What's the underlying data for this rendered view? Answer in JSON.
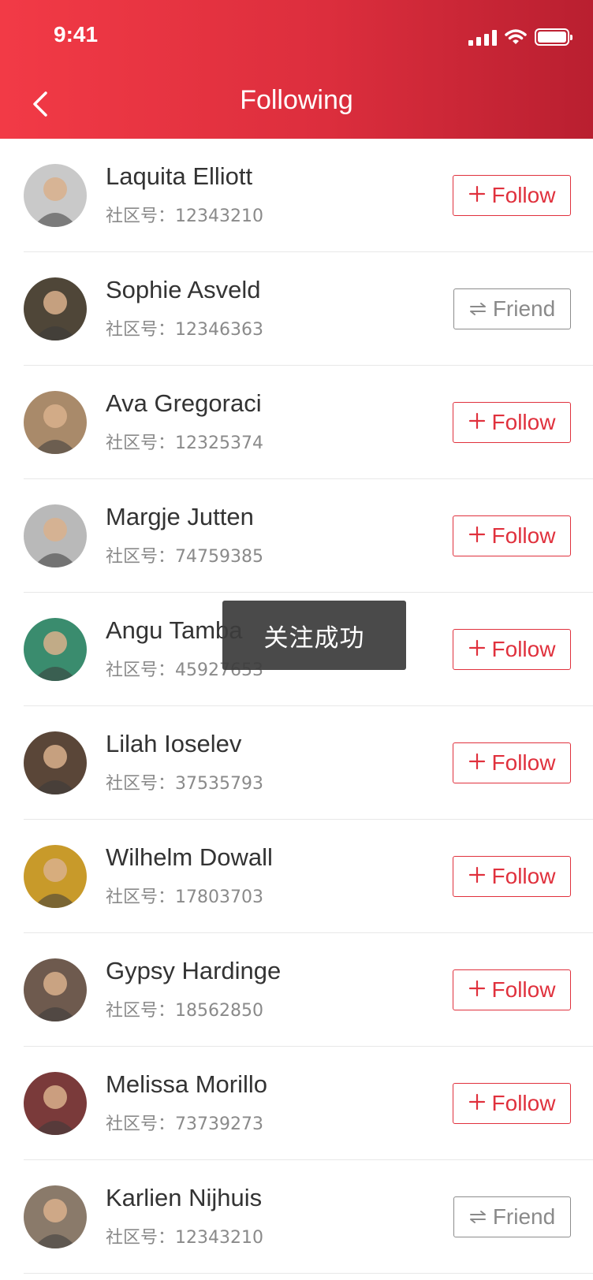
{
  "status_bar": {
    "time": "9:41"
  },
  "header": {
    "title": "Following"
  },
  "toast": {
    "text": "关注成功"
  },
  "buttons": {
    "follow_label": "Follow",
    "friend_label": "Friend",
    "follow_icon": "plus-icon",
    "friend_icon": "swap-arrows-icon"
  },
  "colors": {
    "header_start": "#f23a46",
    "header_end": "#b91f30",
    "accent": "#e0313d"
  },
  "users": [
    {
      "name": "Laquita Elliott",
      "cid": "社区号：12343210",
      "status": "Follow",
      "avatar_color": "#c9c9c9"
    },
    {
      "name": "Sophie Asveld",
      "cid": "社区号：12346363",
      "status": "Friend",
      "avatar_color": "#4f4638"
    },
    {
      "name": "Ava Gregoraci",
      "cid": "社区号：12325374",
      "status": "Follow",
      "avatar_color": "#a98a6a"
    },
    {
      "name": "Margje Jutten",
      "cid": "社区号：74759385",
      "status": "Follow",
      "avatar_color": "#b9b9b9"
    },
    {
      "name": "Angu Tamba",
      "cid": "社区号：45927653",
      "status": "Follow",
      "avatar_color": "#3a8c6e"
    },
    {
      "name": "Lilah Ioselev",
      "cid": "社区号：37535793",
      "status": "Follow",
      "avatar_color": "#5a4638"
    },
    {
      "name": "Wilhelm Dowall",
      "cid": "社区号：17803703",
      "status": "Follow",
      "avatar_color": "#c89a2a"
    },
    {
      "name": "Gypsy Hardinge",
      "cid": "社区号：18562850",
      "status": "Follow",
      "avatar_color": "#6e5a4e"
    },
    {
      "name": "Melissa Morillo",
      "cid": "社区号：73739273",
      "status": "Follow",
      "avatar_color": "#7a3a3a"
    },
    {
      "name": "Karlien Nijhuis",
      "cid": "社区号：12343210",
      "status": "Friend",
      "avatar_color": "#8a7a6a"
    }
  ]
}
